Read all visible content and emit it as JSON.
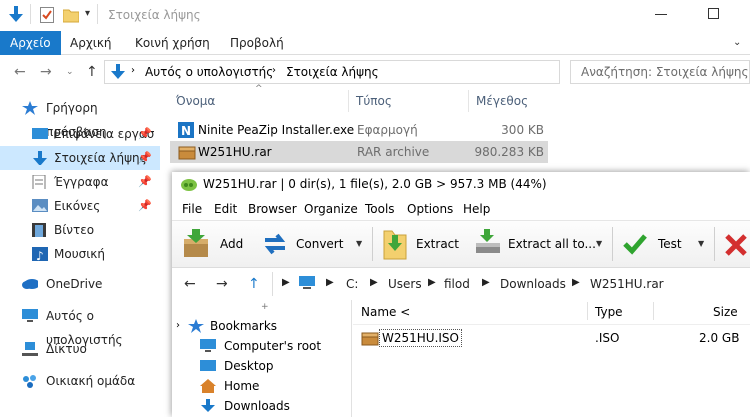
{
  "explorer": {
    "title": "Στοιχεία λήψης",
    "ribbon_tabs": [
      "Αρχείο",
      "Αρχική",
      "Κοινή χρήση",
      "Προβολή"
    ],
    "address": {
      "crumb_1": "Αυτός ο υπολογιστής",
      "crumb_2": "Στοιχεία λήψης"
    },
    "search_placeholder": "Αναζήτηση: Στοιχεία λήψης",
    "nav": [
      {
        "label": "Γρήγορη πρόσβαση",
        "icon": "star-icon"
      },
      {
        "label": "Επιφάνεια εργασ",
        "icon": "desktop-icon",
        "pinned": true
      },
      {
        "label": "Στοιχεία λήψης",
        "icon": "download-icon",
        "pinned": true,
        "selected": true
      },
      {
        "label": "Έγγραφα",
        "icon": "documents-icon",
        "pinned": true
      },
      {
        "label": "Εικόνες",
        "icon": "pictures-icon",
        "pinned": true
      },
      {
        "label": "Βίντεο",
        "icon": "video-icon"
      },
      {
        "label": "Μουσική",
        "icon": "music-icon"
      },
      {
        "label": "OneDrive",
        "icon": "cloud-icon"
      },
      {
        "label": "Αυτός ο υπολογιστής",
        "icon": "computer-icon"
      },
      {
        "label": "Δίκτυο",
        "icon": "network-icon"
      },
      {
        "label": "Οικιακή ομάδα",
        "icon": "homegroup-icon"
      }
    ],
    "columns": {
      "name": "Όνομα",
      "type": "Τύπος",
      "size": "Μέγεθος"
    },
    "files": [
      {
        "name": "Ninite PeaZip Installer.exe",
        "type": "Εφαρμογή",
        "size": "300 KB",
        "icon": "ninite-icon"
      },
      {
        "name": "W251HU.rar",
        "type": "RAR archive",
        "size": "980.283 KB",
        "icon": "archive-icon",
        "selected": true
      }
    ]
  },
  "peazip": {
    "title": "W251HU.rar | 0 dir(s), 1 file(s), 2.0 GB > 957.3 MB (44%)",
    "menu": [
      "File",
      "Edit",
      "Browser",
      "Organize",
      "Tools",
      "Options",
      "Help"
    ],
    "toolbar": {
      "add": "Add",
      "convert": "Convert",
      "extract": "Extract",
      "extract_all": "Extract all to...",
      "test": "Test"
    },
    "path": [
      "C:",
      "Users",
      "filod",
      "Downloads",
      "W251HU.rar"
    ],
    "tree": {
      "bookmarks": "Bookmarks",
      "items": [
        "Computer's root",
        "Desktop",
        "Home",
        "Downloads"
      ]
    },
    "list_columns": {
      "name": "Name <",
      "type": "Type",
      "size": "Size"
    },
    "list_rows": [
      {
        "name": "W251HU.ISO",
        "type": ".ISO",
        "size": "2.0 GB"
      }
    ]
  },
  "colors": {
    "accent": "#1979ca",
    "selection": "#cce8ff",
    "row_selected": "#d9d9d9"
  }
}
